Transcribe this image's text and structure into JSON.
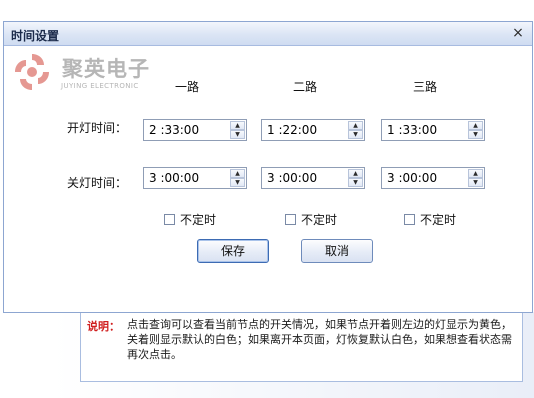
{
  "dialog": {
    "title": "时间设置",
    "close": "×"
  },
  "logo": {
    "name": "聚英电子",
    "subtitle": "JUYING ELECTRONIC"
  },
  "columns": [
    "一路",
    "二路",
    "三路"
  ],
  "rows": {
    "on_label": "开灯时间：",
    "off_label": "关灯时间：",
    "on_values": [
      "2 :33:00",
      "1 :22:00",
      "1 :33:00"
    ],
    "off_values": [
      "3 :00:00",
      "3 :00:00",
      "3 :00:00"
    ]
  },
  "checkbox_label": "不定时",
  "buttons": {
    "save": "保存",
    "cancel": "取消"
  },
  "note": {
    "label": "说明：",
    "text": "点击查询可以查看当前节点的开关情况，如果节点开着则左边的灯显示为黄色，关着则显示默认的白色；如果离开本页面，灯恢复默认白色，如果想查看状态需再次点击。"
  },
  "colors": {
    "logo_red": "#d0453a",
    "note_label": "#d01f1f",
    "titlebar": "#dbe5f5"
  }
}
